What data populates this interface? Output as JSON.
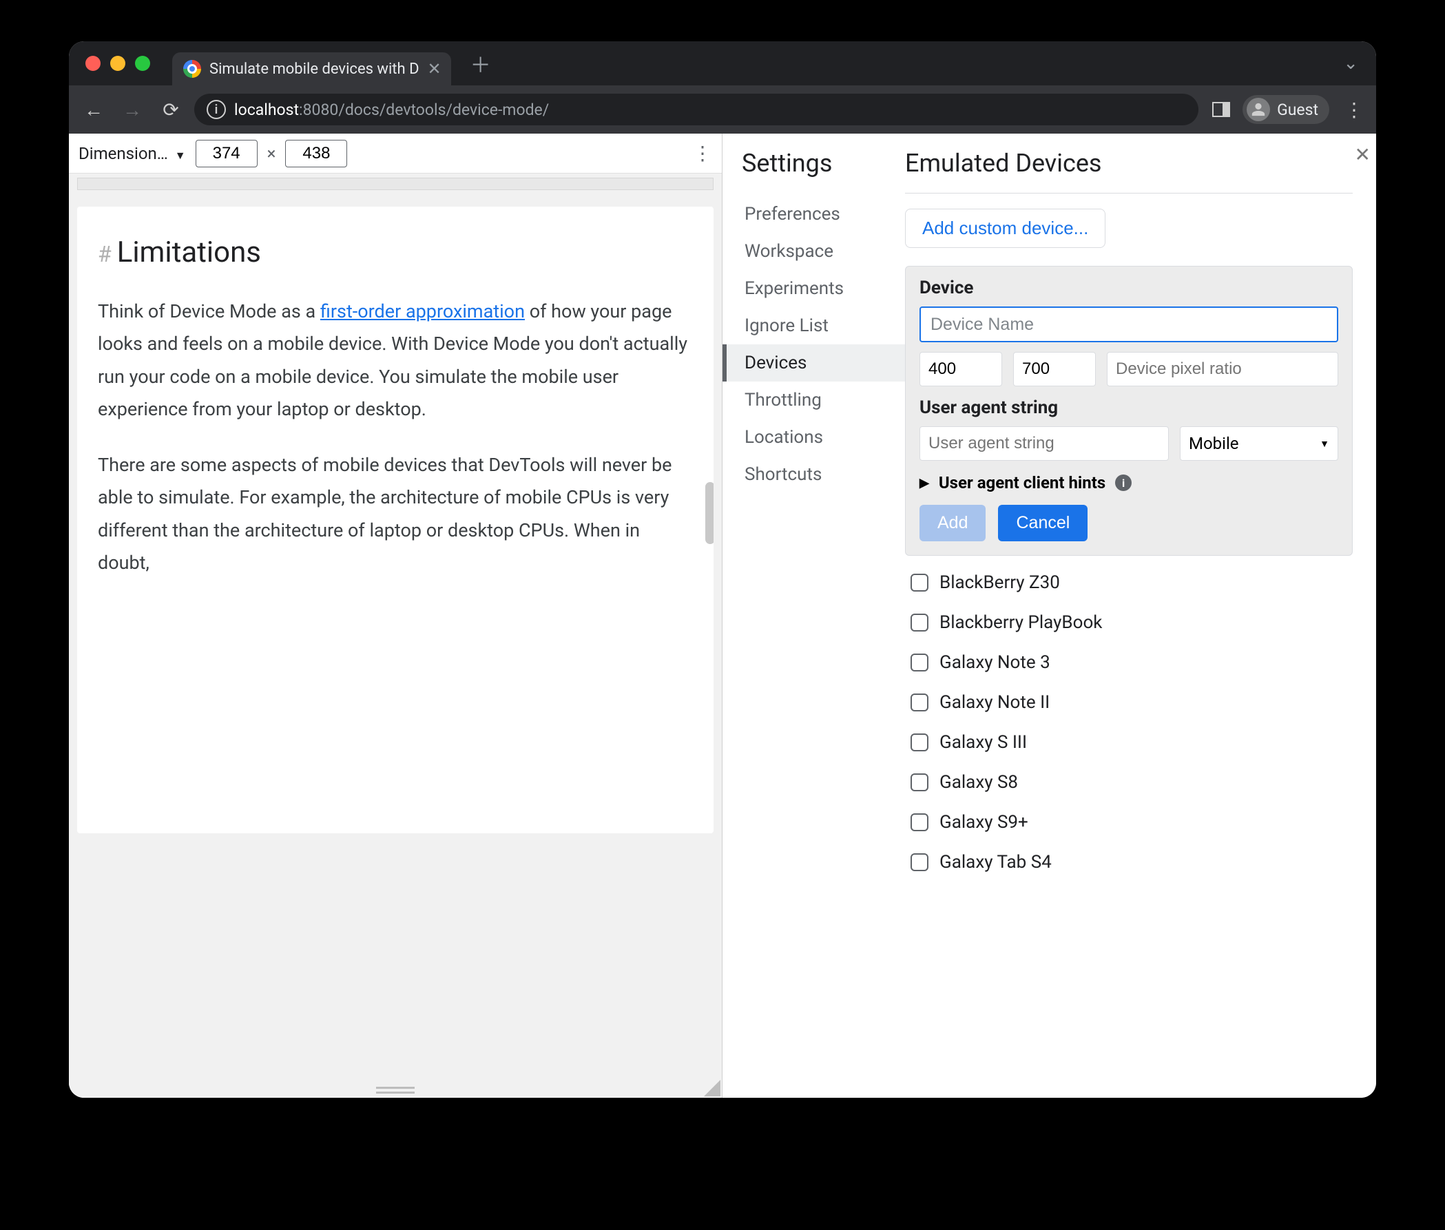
{
  "titlebar": {
    "tab_title": "Simulate mobile devices with D",
    "guest_label": "Guest"
  },
  "omnibox": {
    "host": "localhost",
    "port": ":8080",
    "path": "/docs/devtools/device-mode/"
  },
  "device_bar": {
    "label": "Dimension…",
    "width": "374",
    "height": "438",
    "times": "×"
  },
  "page": {
    "heading": "Limitations",
    "p1_pre": "Think of Device Mode as a ",
    "p1_link": "first-order approximation",
    "p1_post": " of how your page looks and feels on a mobile device. With Device Mode you don't actually run your code on a mobile device. You simulate the mobile user experience from your laptop or desktop.",
    "p2": "There are some aspects of mobile devices that DevTools will never be able to simulate. For example, the architecture of mobile CPUs is very different than the architecture of laptop or desktop CPUs. When in doubt,"
  },
  "settings": {
    "title": "Settings",
    "items": [
      "Preferences",
      "Workspace",
      "Experiments",
      "Ignore List",
      "Devices",
      "Throttling",
      "Locations",
      "Shortcuts"
    ],
    "active_index": 4
  },
  "emulated": {
    "title": "Emulated Devices",
    "add_custom": "Add custom device...",
    "device_label": "Device",
    "name_placeholder": "Device Name",
    "width": "400",
    "height": "700",
    "dpr_placeholder": "Device pixel ratio",
    "ua_label": "User agent string",
    "ua_placeholder": "User agent string",
    "ua_type": "Mobile",
    "hints_label": "User agent client hints",
    "add": "Add",
    "cancel": "Cancel",
    "devices": [
      "BlackBerry Z30",
      "Blackberry PlayBook",
      "Galaxy Note 3",
      "Galaxy Note II",
      "Galaxy S III",
      "Galaxy S8",
      "Galaxy S9+",
      "Galaxy Tab S4"
    ]
  }
}
